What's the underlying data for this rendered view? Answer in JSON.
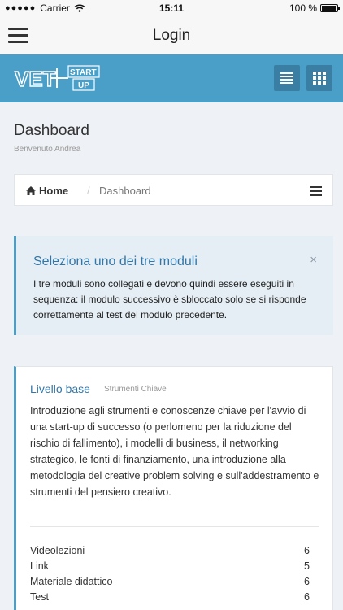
{
  "status_bar": {
    "carrier": "Carrier",
    "time": "15:11",
    "battery_text": "100 %",
    "battery_level": 1.0
  },
  "nav": {
    "title": "Login",
    "menu_icon": "hamburger-icon"
  },
  "header": {
    "logo_text": "VET START UP",
    "brand_color": "#4a9fc8",
    "list_view_icon": "list-view-icon",
    "grid_view_icon": "grid-view-icon"
  },
  "page": {
    "title": "Dashboard",
    "subtitle": "Benvenuto Andrea"
  },
  "breadcrumb": {
    "home": "Home",
    "separator": "/",
    "current": "Dashboard"
  },
  "alert": {
    "title": "Seleziona uno dei tre moduli",
    "close": "×",
    "text": "I tre moduli sono collegati e devono quindi essere eseguiti in sequenza: il modulo successivo è sbloccato solo se si risponde correttamente al test del modulo precedente."
  },
  "card": {
    "title": "Livello base",
    "tag": "Strumenti Chiave",
    "text": "Introduzione agli strumenti e conoscenze chiave per l'avvio di una start-up di successo (o perlomeno per la riduzione del rischio di fallimento), i modelli di business, il networking strategico, le fonti di finanziamento, una introduzione alla metodologia del creative problem solving e sull'addestramento e strumenti del pensiero creativo.",
    "stats": [
      {
        "label": "Videolezioni",
        "value": "6"
      },
      {
        "label": "Link",
        "value": "5"
      },
      {
        "label": "Materiale didattico",
        "value": "6"
      },
      {
        "label": "Test",
        "value": "6"
      }
    ]
  }
}
